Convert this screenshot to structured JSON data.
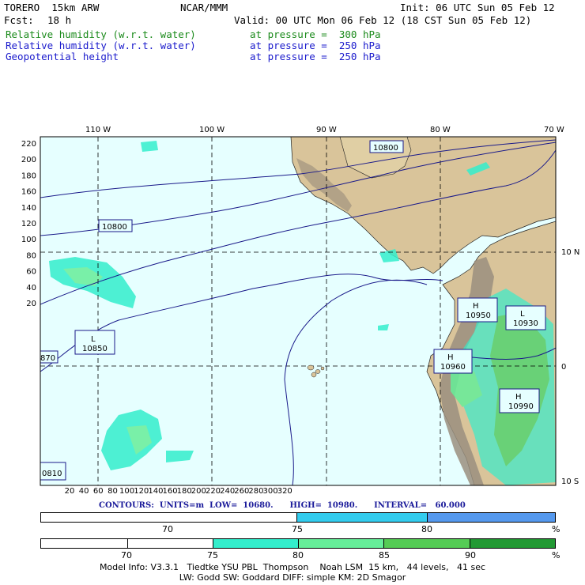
{
  "header": {
    "model": "TORERO  15km ARW",
    "center": "NCAR/MMM",
    "init": "Init: 06 UTC Sun 05 Feb 12",
    "fcst_label": "Fcst:",
    "fcst_value": "18 h",
    "valid": "Valid: 00 UTC Mon 06 Feb 12 (18 CST Sun 05 Feb 12)",
    "fields": [
      {
        "name": "Relative humidity (w.r.t. water)",
        "level": "at pressure =  300 hPa",
        "color": "#1a8a1a"
      },
      {
        "name": "Relative humidity (w.r.t. water)",
        "level": "at pressure =  250 hPa",
        "color": "#1a1acc"
      },
      {
        "name": "Geopotential height",
        "level": "at pressure =  250 hPa",
        "color": "#1a1acc"
      }
    ]
  },
  "map": {
    "top_lon_labels": [
      "110 W",
      "100 W",
      "90 W",
      "80 W",
      "70 W"
    ],
    "right_lat_labels": [
      "10 N",
      "0",
      "10 S"
    ],
    "left_y_ticks": [
      "220",
      "200",
      "180",
      "160",
      "140",
      "120",
      "100",
      "80",
      "60",
      "40",
      "20"
    ],
    "bottom_x_ticks": [
      "20",
      "40",
      "60",
      "80",
      "100",
      "120",
      "140",
      "160",
      "180",
      "200",
      "220",
      "240",
      "260",
      "280",
      "300",
      "320"
    ],
    "height_labels": [
      "10800",
      "10800",
      "10850",
      "10950",
      "10930",
      "10960",
      "10990",
      "870",
      "0810"
    ],
    "highs_lows": [
      {
        "symbol": "H",
        "value": "10950"
      },
      {
        "symbol": "L",
        "value": "10930"
      },
      {
        "symbol": "H",
        "value": "10960"
      },
      {
        "symbol": "H",
        "value": "10990"
      },
      {
        "symbol": "L",
        "value": "10850"
      }
    ],
    "colors": {
      "ocean": "#e6ffff",
      "land": "#d9c49a",
      "mountain": "#9a8f7f",
      "contour": "#1a1a8a"
    }
  },
  "contour_info": "CONTOURS:  UNITS=m  LOW=  10680.      HIGH=  10980.      INTERVAL=   60.000",
  "colorbar_250": {
    "labels": [
      "70",
      "75",
      "80",
      "%"
    ],
    "colors": [
      "#ffffff",
      "#33ccee",
      "#5599ee"
    ]
  },
  "colorbar_300": {
    "labels": [
      "70",
      "75",
      "80",
      "85",
      "90",
      "%"
    ],
    "colors": [
      "#ffffff",
      "#ffffff",
      "#33eecc",
      "#66ee99",
      "#55cc55",
      "#229933"
    ]
  },
  "footer": {
    "line1": "Model Info: V3.3.1   Tiedtke YSU PBL  Thompson    Noah LSM  15 km,   44 levels,   41 sec",
    "line2": "LW: Godd SW: Goddard DIFF: simple KM: 2D Smagor"
  }
}
